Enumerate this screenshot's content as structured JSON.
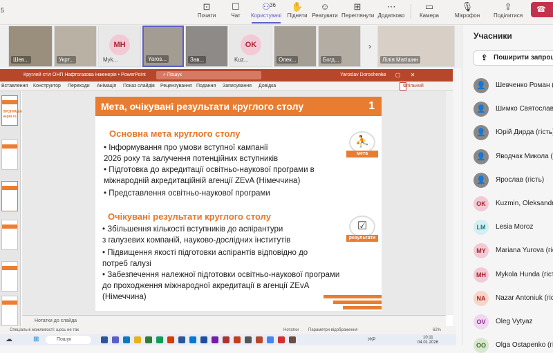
{
  "toolbar": {
    "left_number": "5",
    "items": [
      {
        "label": "Почати",
        "icon": "camera-record-icon"
      },
      {
        "label": "Чат",
        "icon": "chat-icon"
      },
      {
        "label": "Користувачі",
        "icon": "people-icon",
        "count": "36"
      },
      {
        "label": "Підняти",
        "icon": "raise-hand-icon"
      },
      {
        "label": "Реагувати",
        "icon": "react-icon"
      },
      {
        "label": "Переглянути",
        "icon": "view-icon"
      },
      {
        "label": "Додатково",
        "icon": "more-icon"
      },
      {
        "label": "Камера",
        "icon": "camera-icon"
      },
      {
        "label": "Мікрофон",
        "icon": "microphone-icon"
      },
      {
        "label": "Поділитися",
        "icon": "share-icon"
      }
    ]
  },
  "video_tiles": [
    {
      "name": "Шев...",
      "type": "video"
    },
    {
      "name": "Укрт...",
      "type": "video"
    },
    {
      "name": "Myk...",
      "type": "avatar",
      "initials": "MH",
      "color": "#f4c9d6",
      "text_color": "#a4262c"
    },
    {
      "name": "Yaros...",
      "type": "video",
      "selected": true
    },
    {
      "name": "Зав...",
      "type": "video"
    },
    {
      "name": "Kuz...",
      "type": "avatar",
      "initials": "OK",
      "color": "#f4c9d6",
      "text_color": "#a4262c"
    },
    {
      "name": "Олек...",
      "type": "video"
    },
    {
      "name": "Богд...",
      "type": "video"
    },
    {
      "name": "Лілія Матішин",
      "type": "video"
    }
  ],
  "powerpoint": {
    "title": "Круглий стіл ОНП Нафтогазова інженерія  •  PowerPoint",
    "search_placeholder": "Пошук",
    "user": "Yaroslav Doroshenko",
    "menu": [
      "Вставлення",
      "Конструктор",
      "Переходи",
      "Анімація",
      "Показ слайдів",
      "Рецензування",
      "Подання",
      "Записування",
      "Довідка"
    ],
    "share_label": "Спільний доступ",
    "thumbnail_texts": [
      "ПРОГРАМА",
      "нерія та"
    ],
    "notes_label": "Нотатки до слайда",
    "status_text": "Спеціальні можливості: щось не так",
    "zoom": "62%",
    "notes_btn": "Нотатки",
    "display_btn": "Параметри відображення"
  },
  "slide": {
    "header": "Мета, очікувані результати круглого столу",
    "page_number": "1",
    "section1_title": "Основна мета круглого столу",
    "section1_lines": [
      "• Інформування  про  умови  вступної  кампанії",
      "2026 року  та залучення потенційних вступників",
      "• Підготовка  до  акредитації  освітньо-наукової  програми  в",
      "міжнародній акредитаційній агенції ZEvA (Німеччина)",
      "• Представлення освітньо-наукової програми"
    ],
    "icon1_label": "мета",
    "section2_title": "Очікувані результати круглого столу",
    "section2_lines": [
      "• Збільшення кількості вступників до аспірантури",
      "з галузевих компаній, науково-дослідних інститутів",
      "• Підвищення якості підготовки аспірантів відповідно до",
      "потреб галузі",
      "• Забезпечення належної підготовки освітньо-наукової програми",
      "до  проходження  міжнародної  акредитації  в  агенції  ZEvA",
      "(Німеччина)"
    ],
    "icon2_label": "результати"
  },
  "taskbar": {
    "search": "Пошук",
    "lang": "УКР",
    "time": "10:11",
    "date": "04.01.2026"
  },
  "participants_panel": {
    "title": "Учасники",
    "invite_label": "Поширити запрошення",
    "people": [
      {
        "name": "Шевченко Роман (гість)",
        "initials": "",
        "color": "#8a8886"
      },
      {
        "name": "Шимко Святослав (гість)",
        "initials": "",
        "color": "#8a8886"
      },
      {
        "name": "Юрій Дирда (гість)",
        "initials": "",
        "color": "#8a8886"
      },
      {
        "name": "Яводчак Микола (гість)",
        "initials": "",
        "color": "#8a8886"
      },
      {
        "name": "Ярослав (гість)",
        "initials": "",
        "color": "#8a8886"
      },
      {
        "name": "Kuzmin, Oleksandr",
        "initials": "OK",
        "color": "#f4c9d6",
        "text_color": "#a4262c"
      },
      {
        "name": "Lesia Moroz",
        "initials": "LM",
        "color": "#d4eef2",
        "text_color": "#0e7a8a"
      },
      {
        "name": "Mariana Yurova (гість)",
        "initials": "MY",
        "color": "#f4c9d6",
        "text_color": "#a4262c"
      },
      {
        "name": "Mykola Hunda (гість)",
        "initials": "MH",
        "color": "#f4c9d6",
        "text_color": "#a4262c"
      },
      {
        "name": "Nazar Antoniuk (гість)",
        "initials": "NA",
        "color": "#f7d6c9",
        "text_color": "#a4262c"
      },
      {
        "name": "Oleg Vytyaz",
        "initials": "OV",
        "color": "#f0d6f0",
        "text_color": "#8a2a8a"
      },
      {
        "name": "Olga Ostapenko (гість)",
        "initials": "OO",
        "color": "#d8e7cf",
        "text_color": "#3b6a1f"
      }
    ]
  }
}
